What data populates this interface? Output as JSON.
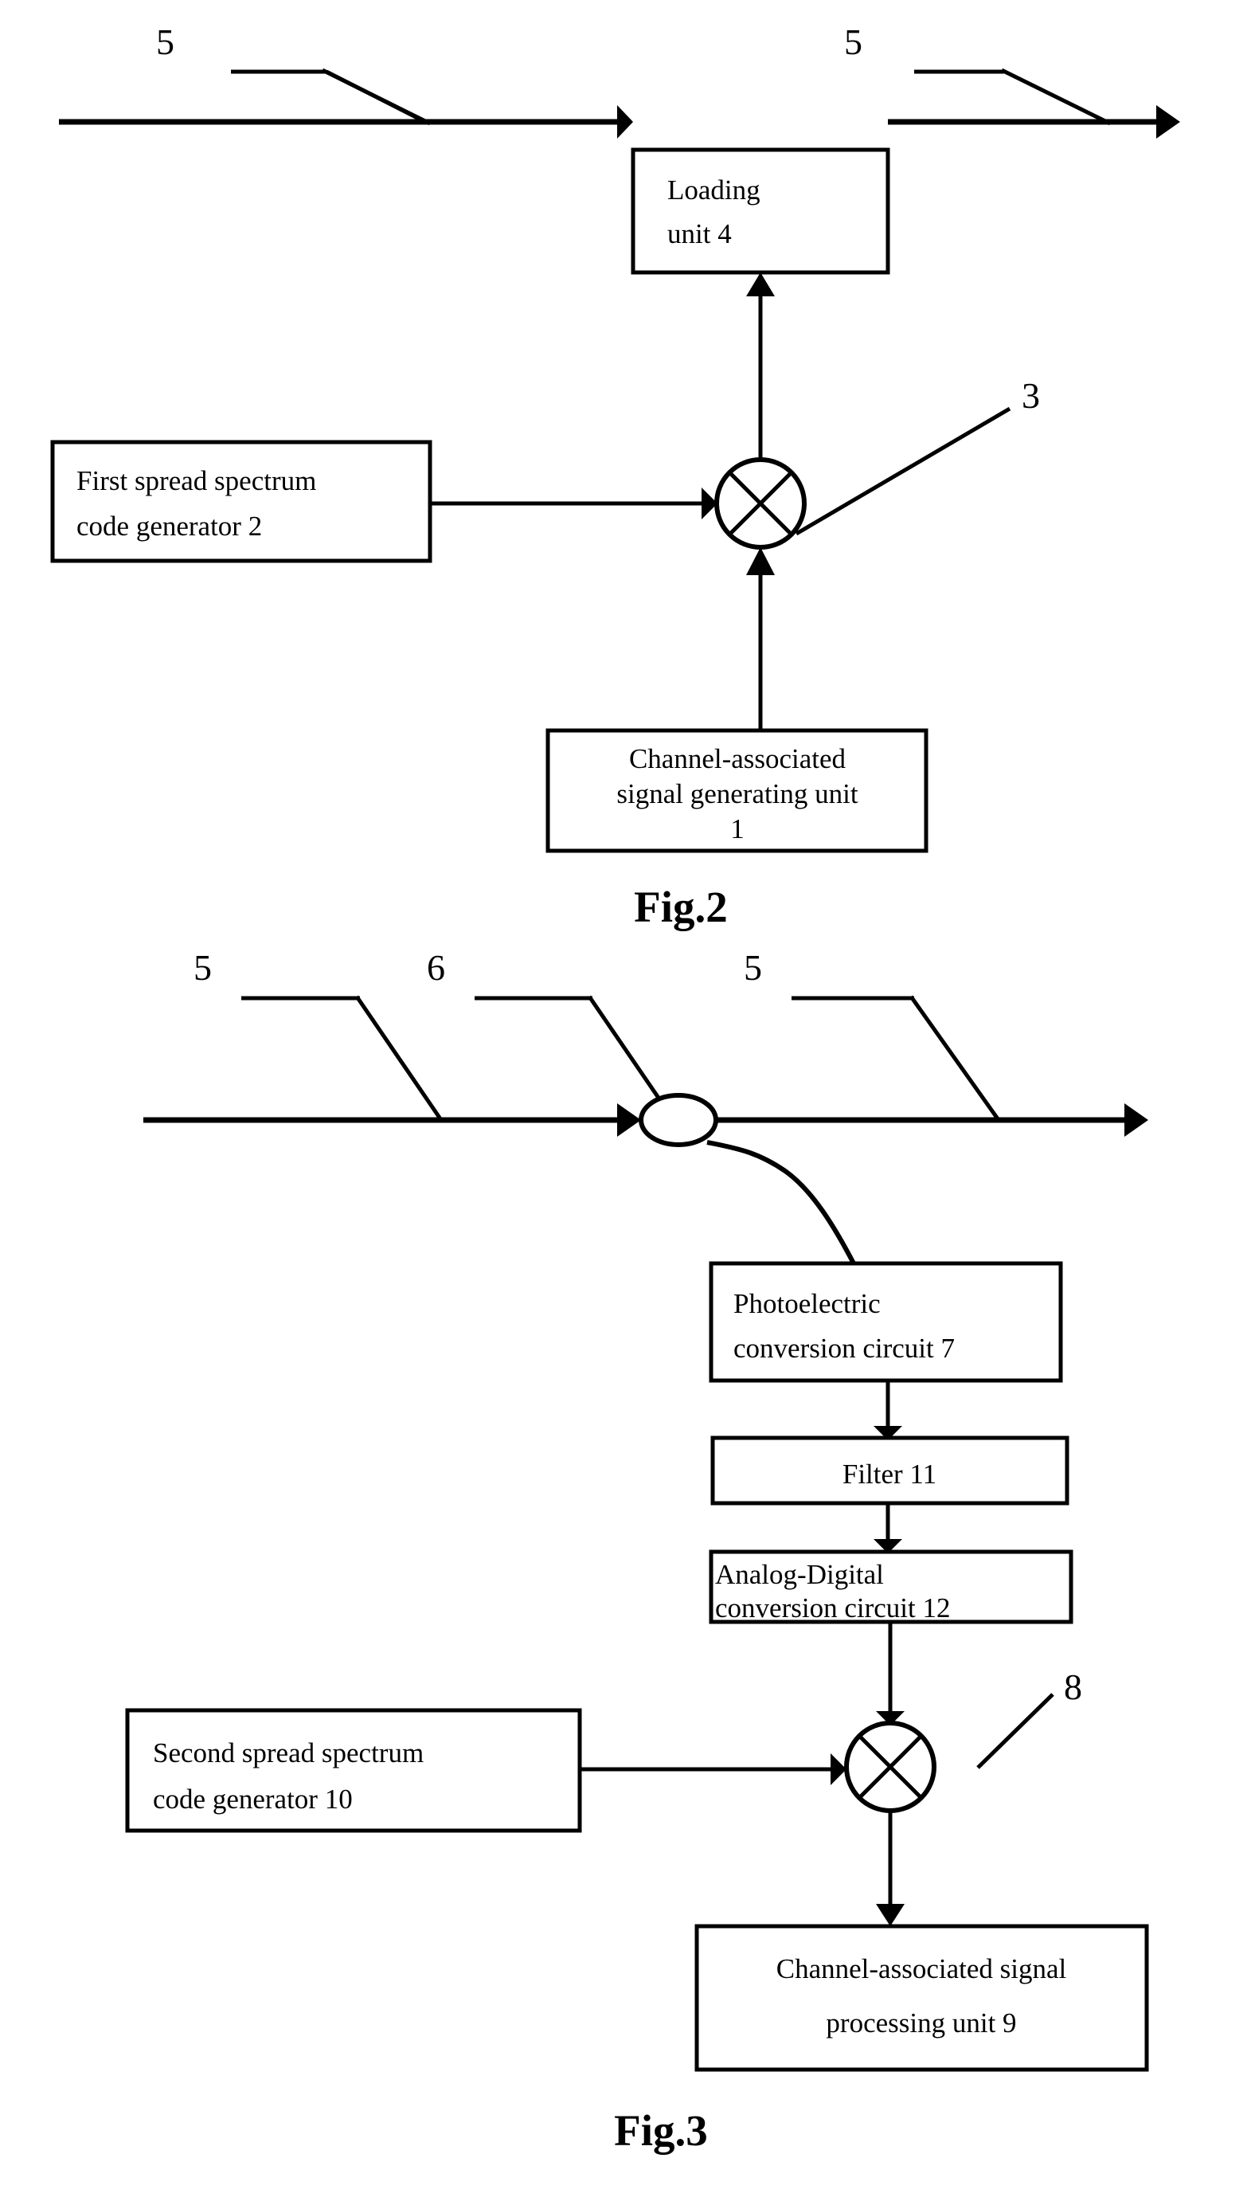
{
  "document": {
    "type": "patent-figure-sheet",
    "figures": [
      {
        "id": "fig2",
        "caption": "Fig.2",
        "title": "Channel-associated signal loading transmitter block diagram",
        "blocks": [
          {
            "name": "loading-unit",
            "lines": [
              "Loading",
              "unit 4"
            ],
            "ref": "4"
          },
          {
            "name": "first-spread-spectrum-code-generator",
            "lines": [
              "First   spread   spectrum",
              "code generator 2"
            ],
            "ref": "2"
          },
          {
            "name": "channel-associated-signal-generating-unit",
            "lines": [
              "Channel-associated",
              "signal generating unit",
              "1"
            ],
            "ref": "1"
          }
        ],
        "mixer": {
          "name": "mixer-3",
          "ref": "3"
        },
        "leaders": [
          {
            "name": "leader-5-left",
            "ref": "5"
          },
          {
            "name": "leader-5-right",
            "ref": "5"
          }
        ]
      },
      {
        "id": "fig3",
        "caption": "Fig.3",
        "title": "Channel-associated signal receiving block diagram",
        "blocks": [
          {
            "name": "photoelectric-conversion-circuit",
            "lines": [
              "Photoelectric",
              "conversion circuit 7"
            ],
            "ref": "7"
          },
          {
            "name": "filter",
            "lines": [
              "Filter 11"
            ],
            "ref": "11"
          },
          {
            "name": "analog-digital-conversion-circuit",
            "lines": [
              "Analog-Digital",
              "conversion circuit 12"
            ],
            "ref": "12"
          },
          {
            "name": "second-spread-spectrum-code-generator",
            "lines": [
              "Second   spread   spectrum",
              "code generator 10"
            ],
            "ref": "10"
          },
          {
            "name": "channel-associated-signal-processing-unit",
            "lines": [
              "Channel-associated signal",
              "processing unit 9"
            ],
            "ref": "9"
          }
        ],
        "mixer": {
          "name": "mixer-8",
          "ref": "8"
        },
        "coupler": {
          "name": "optical-coupler",
          "ref": "6"
        },
        "leaders": [
          {
            "name": "leader-5-left",
            "ref": "5"
          },
          {
            "name": "leader-6-middle",
            "ref": "6"
          },
          {
            "name": "leader-5-right",
            "ref": "5"
          }
        ]
      }
    ],
    "colors": {
      "ink": "#000000",
      "paper": "#ffffff"
    }
  },
  "labels": {
    "fig2": {
      "loading_unit_l1": "Loading",
      "loading_unit_l2": "unit 4",
      "first_gen_l1": "First   spread   spectrum",
      "first_gen_l2": "code generator 2",
      "cas_gen_l1": "Channel-associated",
      "cas_gen_l2": "signal generating unit",
      "cas_gen_l3": "1",
      "ref_5_left": "5",
      "ref_5_right": "5",
      "ref_3": "3",
      "caption": "Fig.2"
    },
    "fig3": {
      "photo_l1": "Photoelectric",
      "photo_l2": "conversion circuit 7",
      "filter_l1": "Filter 11",
      "adc_l1": "Analog-Digital",
      "adc_l2": "conversion circuit 12",
      "second_gen_l1": "Second   spread   spectrum",
      "second_gen_l2": "code generator 10",
      "cas_proc_l1": "Channel-associated signal",
      "cas_proc_l2": "processing unit 9",
      "ref_5_left": "5",
      "ref_6_mid": "6",
      "ref_5_right": "5",
      "ref_8": "8",
      "caption": "Fig.3"
    }
  }
}
